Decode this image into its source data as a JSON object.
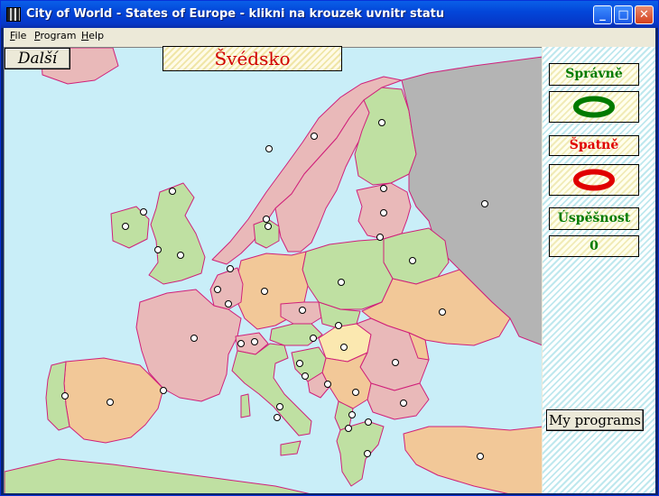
{
  "window": {
    "title": "City of World - States of Europe - klikni na krouzek uvnitr statu",
    "minimize_glyph": "_",
    "maximize_glyph": "□",
    "close_glyph": "✕"
  },
  "menu": {
    "file_first": "F",
    "file_rest": "ile",
    "program_first": "P",
    "program_rest": "rogram",
    "help_first": "H",
    "help_rest": "elp"
  },
  "toolbar": {
    "next_label": "Další",
    "target_state": "Švédsko"
  },
  "score": {
    "correct_label": "Správně",
    "wrong_label": "Špatně",
    "success_label": "Úspěšnost",
    "success_value": "0"
  },
  "footer": {
    "my_programs_label": "My programs"
  },
  "colors": {
    "sea": "#c9eef8",
    "correct": "#007a00",
    "wrong": "#e00000",
    "pink": "#e9b9b9",
    "green": "#bfe0a2",
    "orange": "#f2c898",
    "gray": "#b4b4b4",
    "yellow": "#fbe8b0"
  },
  "icons": {
    "app": "app-icon",
    "correct_indicator": "green-ring-icon",
    "wrong_indicator": "red-ring-icon",
    "state_marker": "white-circle-icon"
  }
}
